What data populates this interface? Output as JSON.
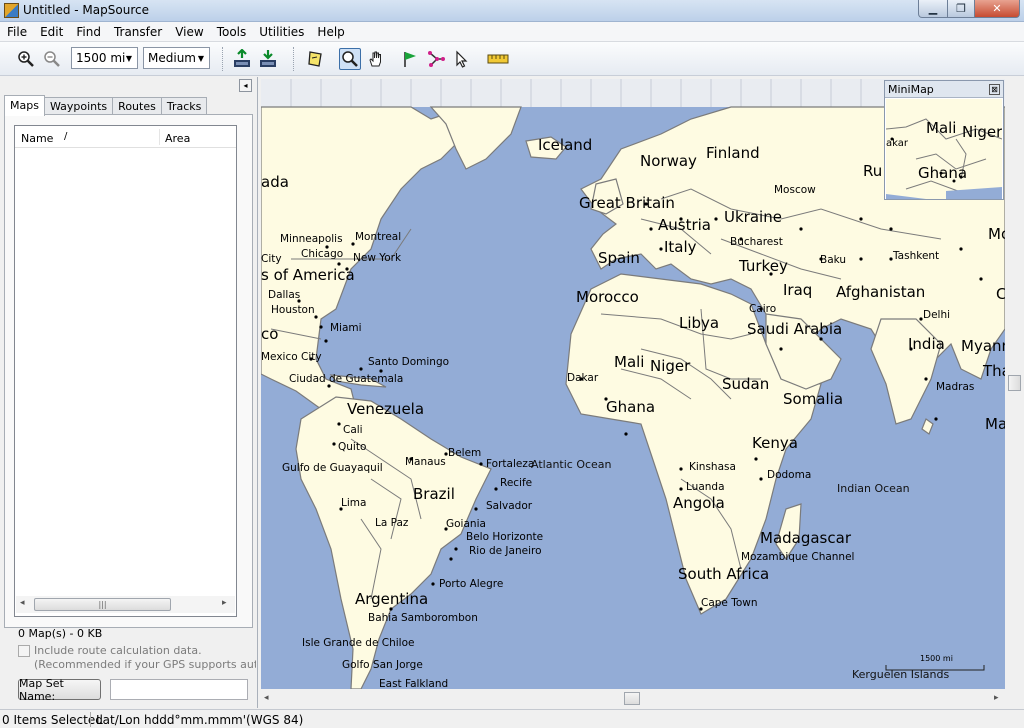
{
  "window": {
    "title": "Untitled - MapSource",
    "min_label": "▁",
    "max_label": "❐",
    "close_label": "✕"
  },
  "menu": [
    "File",
    "Edit",
    "Find",
    "Transfer",
    "View",
    "Tools",
    "Utilities",
    "Help"
  ],
  "toolbar": {
    "zoom_value": "1500 mi",
    "detail_value": "Medium",
    "combo_arrow": "▼",
    "icons": [
      "zoom-in-icon",
      "zoom-out-icon",
      "receive-from-device-icon",
      "send-to-device-icon",
      "map-tool-icon",
      "zoom-tool-icon",
      "hand-tool-icon",
      "waypoint-tool-icon",
      "route-tool-icon",
      "selection-tool-icon",
      "measure-tool-icon"
    ],
    "active_tool": "zoom-tool-icon"
  },
  "left_panel": {
    "collapse_label": "◂",
    "tabs": [
      "Maps",
      "Waypoints",
      "Routes",
      "Tracks"
    ],
    "selected_tab": "Maps",
    "list_columns": {
      "name": "Name",
      "sort_indicator": "/",
      "area": "Area"
    },
    "scroll_left": "◂",
    "scroll_right": "▸",
    "scroll_grip": "|||",
    "summary": "0 Map(s) - 0 KB",
    "route_calc_label": "Include route calculation data.",
    "route_calc_note": "(Recommended if your GPS supports auto-routing)",
    "mapset_button": "Map Set Name:",
    "mapset_value": ""
  },
  "map": {
    "colors": {
      "water": "#93acd6",
      "land": "#fefbe2",
      "border": "#7b7b7b"
    },
    "scale_label": "1500 mi",
    "country_labels": [
      "Iceland",
      "Norway",
      "Finland",
      "Great Britain",
      "Austria",
      "Ukraine",
      "Italy",
      "Spain",
      "Turkey",
      "Morocco",
      "Iraq",
      "Afghanistan",
      "Libya",
      "Saudi Arabia",
      "India",
      "Myanm",
      "Tha",
      "Mali",
      "Niger",
      "Sudan",
      "Ghana",
      "Somalia",
      "Venezuela",
      "Kenya",
      "Brazil",
      "Angola",
      "Madagascar",
      "South Africa",
      "Argentina",
      "s of America",
      "ada",
      "Ru",
      "Mo",
      "C",
      "Ma",
      "co"
    ],
    "city_labels": [
      "Minneapolis",
      "Montreal",
      "Chicago",
      "New York",
      "City",
      "Dallas",
      "Houston",
      "Miami",
      "Mexico City",
      "Santo Domingo",
      "Ciudad de Guatemala",
      "Cali",
      "Quito",
      "Gulfo de Guayaquil",
      "Lima",
      "Manaus",
      "Belem",
      "Fortaleza",
      "Recife",
      "Salvador",
      "Goiania",
      "La Paz",
      "Belo Horizonte",
      "Rio de Janeiro",
      "Porto Alegre",
      "Bahia Samborombon",
      "Isle Grande de Chiloe",
      "Golfo San Jorge",
      "East Falkland",
      "Dakar",
      "Kinshasa",
      "Luanda",
      "Dodoma",
      "Cape Town",
      "Cairo",
      "Moscow",
      "Bucharest",
      "Baku",
      "Tashkent",
      "Delhi",
      "Madras",
      "Mozambique Channel"
    ],
    "sea_labels": [
      "Atlantic Ocean",
      "Indian Ocean",
      "Kerguelen Islands"
    ]
  },
  "minimap": {
    "title": "MiniMap",
    "close_label": "⊠",
    "labels": [
      "Mali",
      "Niger",
      "Ghana",
      "akar"
    ]
  },
  "scrollbars": {
    "left_arrow": "◂",
    "right_arrow": "▸"
  },
  "status": {
    "items_selected": "0 Items Selected",
    "position_format": "Lat/Lon hddd°mm.mmm'(WGS 84)"
  }
}
